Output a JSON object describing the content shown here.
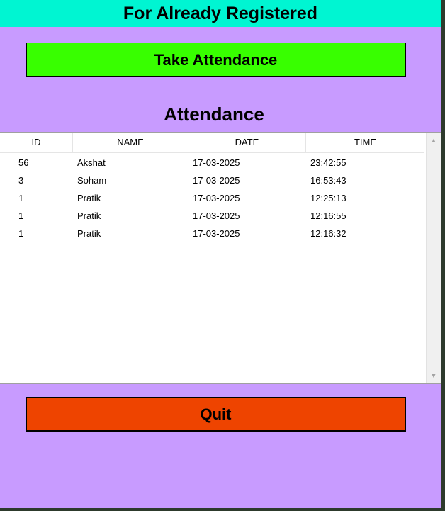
{
  "header": {
    "title": "For Already Registered"
  },
  "take_attendance_button": {
    "label": "Take Attendance"
  },
  "attendance_title": "Attendance",
  "table": {
    "columns": [
      "ID",
      "NAME",
      "DATE",
      "TIME"
    ],
    "rows": [
      [
        "56",
        "Akshat",
        "17-03-2025",
        "23:42:55"
      ],
      [
        "3",
        "Soham",
        "17-03-2025",
        "16:53:43"
      ],
      [
        "1",
        "Pratik",
        "17-03-2025",
        "12:25:13"
      ],
      [
        "1",
        "Pratik",
        "17-03-2025",
        "12:16:55"
      ],
      [
        "1",
        "Pratik",
        "17-03-2025",
        "12:16:32"
      ]
    ]
  },
  "scrollbar": {
    "up_icon": "▲",
    "down_icon": "▼"
  },
  "quit_button": {
    "label": "Quit"
  },
  "colors": {
    "header_bg": "#00f5d2",
    "window_bg": "#c89bff",
    "take_button_bg": "#38ff00",
    "quit_button_bg": "#ee4400"
  }
}
